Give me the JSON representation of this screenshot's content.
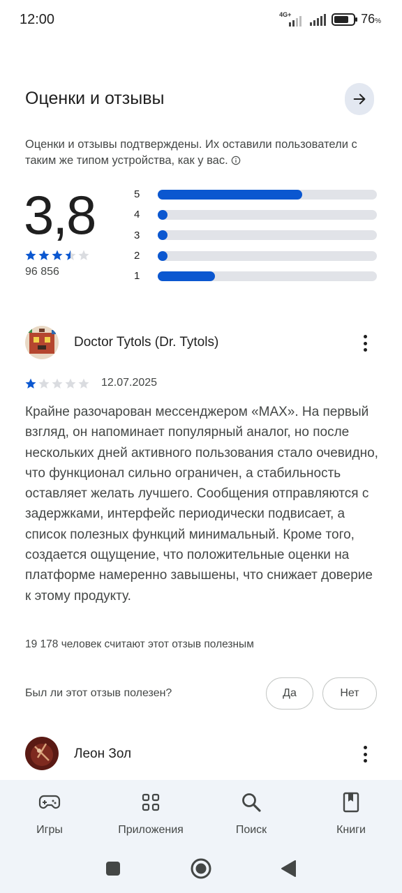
{
  "status_bar": {
    "time": "12:00",
    "network_label": "4G+",
    "battery_percent": "76",
    "battery_unit": "%",
    "battery_level": 0.76
  },
  "ratings": {
    "title": "Оценки и отзывы",
    "verified_note": "Оценки и отзывы подтверждены. Их оставили пользователи с таким же типом устройства, как у вас.",
    "average": "3,8",
    "average_stars": 3.5,
    "total_count": "96 856",
    "histogram": [
      {
        "label": "5",
        "fraction": 0.66
      },
      {
        "label": "4",
        "fraction": 0.04
      },
      {
        "label": "3",
        "fraction": 0.04
      },
      {
        "label": "2",
        "fraction": 0.04
      },
      {
        "label": "1",
        "fraction": 0.26
      }
    ],
    "accent_color": "#0b57d0"
  },
  "review1": {
    "name": "Doctor Tytols (Dr. Tytols)",
    "stars": 1,
    "date": "12.07.2025",
    "text": "Крайне разочарован мессенджером «MAX». На первый взгляд, он напоминает популярный аналог, но после нескольких дней активного пользования стало очевидно, что функционал сильно ограничен, а стабильность оставляет желать лучшего. Сообщения отправляются с задержками, интерфейс периодически подвисает, а список полезных функций минимальный. Кроме того, создается ощущение, что положительные оценки на платформе намеренно завышены, что снижает доверие к этому продукту.",
    "helpful_count": "19 178 человек считают этот отзыв полезным",
    "helpful_question": "Был ли этот отзыв полезен?",
    "yes_label": "Да",
    "no_label": "Нет"
  },
  "review2": {
    "name": "Леон Зол"
  },
  "bottom_nav": [
    {
      "label": "Игры",
      "icon": "gamepad-icon"
    },
    {
      "label": "Приложения",
      "icon": "apps-grid-icon"
    },
    {
      "label": "Поиск",
      "icon": "search-icon"
    },
    {
      "label": "Книги",
      "icon": "book-icon"
    }
  ]
}
